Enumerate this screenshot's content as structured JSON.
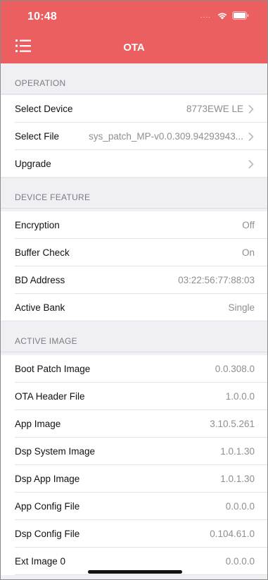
{
  "status_bar": {
    "time": "10:48",
    "dots": "...."
  },
  "nav": {
    "title": "OTA"
  },
  "operation": {
    "header": "OPERATION",
    "rows": [
      {
        "label": "Select Device",
        "value": "8773EWE LE"
      },
      {
        "label": "Select File",
        "value": "sys_patch_MP-v0.0.309.94293943..."
      },
      {
        "label": "Upgrade",
        "value": ""
      }
    ]
  },
  "device_feature": {
    "header": "DEVICE FEATURE",
    "rows": [
      {
        "label": "Encryption",
        "value": "Off"
      },
      {
        "label": "Buffer Check",
        "value": "On"
      },
      {
        "label": "BD Address",
        "value": "03:22:56:77:88:03"
      },
      {
        "label": "Active Bank",
        "value": "Single"
      }
    ]
  },
  "active_image": {
    "header": "ACTIVE IMAGE",
    "rows": [
      {
        "label": "Boot Patch Image",
        "value": "0.0.308.0"
      },
      {
        "label": "OTA Header File",
        "value": "1.0.0.0"
      },
      {
        "label": "App Image",
        "value": "3.10.5.261"
      },
      {
        "label": "Dsp System Image",
        "value": "1.0.1.30"
      },
      {
        "label": "Dsp App Image",
        "value": "1.0.1.30"
      },
      {
        "label": "App Config File",
        "value": "0.0.0.0"
      },
      {
        "label": "Dsp Config File",
        "value": "0.104.61.0"
      },
      {
        "label": "Ext Image 0",
        "value": "0.0.0.0"
      }
    ]
  },
  "colors": {
    "accent": "#ec5f61",
    "background": "#efeff4",
    "secondary_text": "#8e8e93"
  },
  "icons": [
    "menu-icon",
    "wifi-icon",
    "battery-icon",
    "chevron-right-icon"
  ]
}
